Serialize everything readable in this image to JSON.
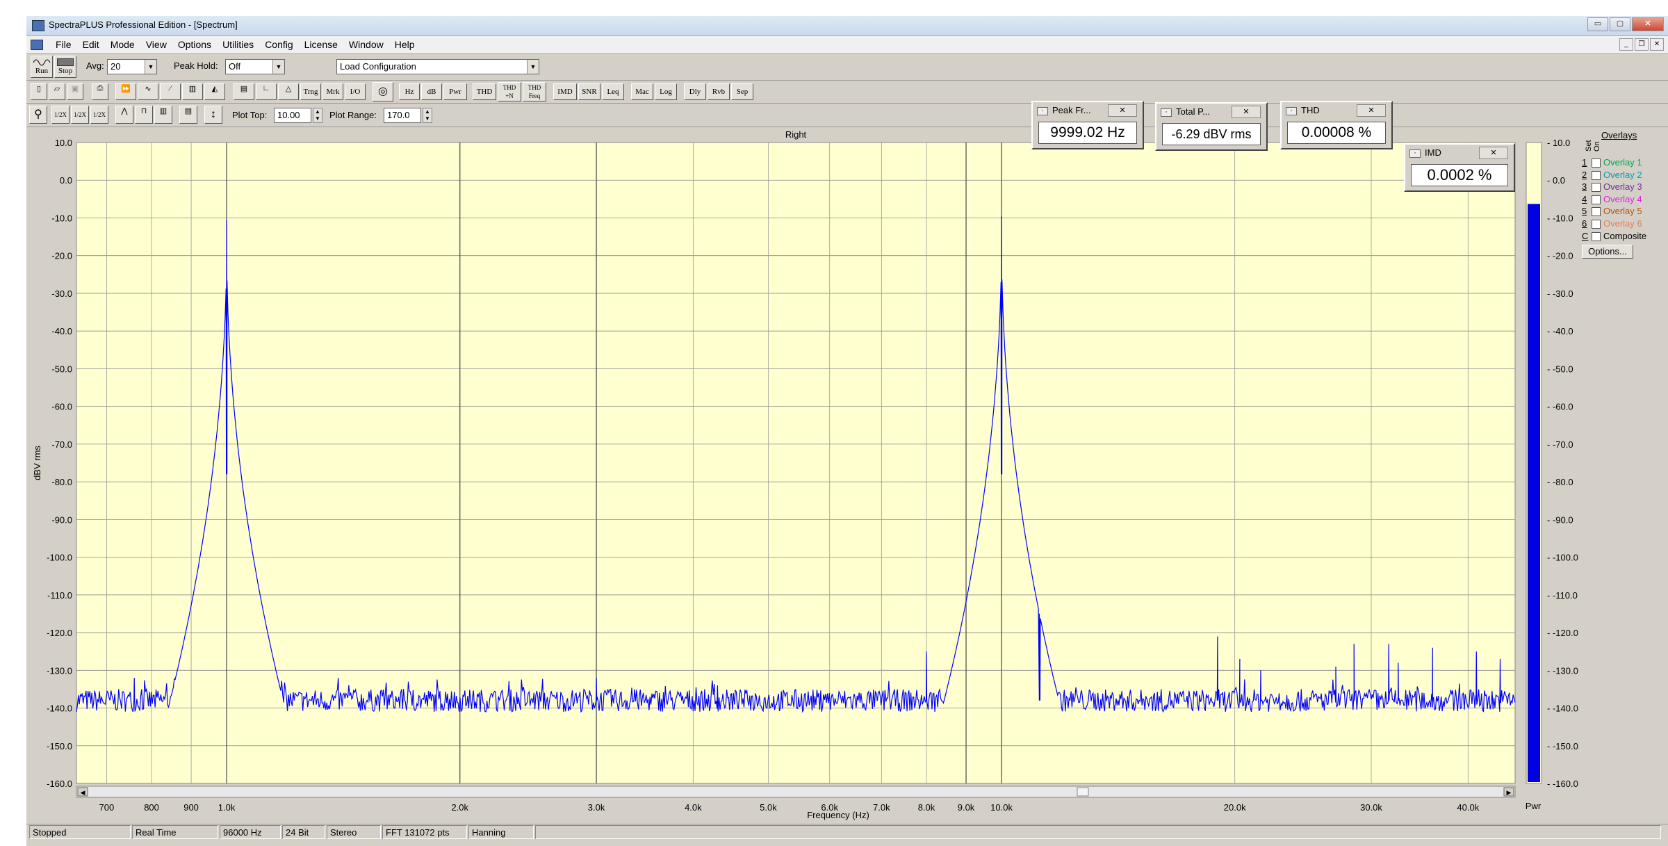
{
  "window": {
    "title": "SpectraPLUS Professional Edition - [Spectrum]",
    "controls": [
      "▭",
      "▢",
      "✕"
    ]
  },
  "menu": [
    "File",
    "Edit",
    "Mode",
    "View",
    "Options",
    "Utilities",
    "Config",
    "License",
    "Window",
    "Help"
  ],
  "toolbar1": {
    "run": "Run",
    "stop": "Stop",
    "avg_label": "Avg:",
    "avg_value": "20",
    "peak_label": "Peak Hold:",
    "peak_value": "Off",
    "config_value": "Load Configuration"
  },
  "toolbar2": {
    "buttons": [
      "Trng",
      "Mrk",
      "I/O",
      "Hz",
      "dB",
      "Pwr",
      "THD",
      "THD +N",
      "THD Freq",
      "IMD",
      "SNR",
      "Leq",
      "Mac",
      "Log",
      "Dly",
      "Rvb",
      "Sep"
    ]
  },
  "toolbar3": {
    "zoom_buttons": [
      "1/2X",
      "1/2X",
      "1/2X"
    ],
    "plot_top_label": "Plot Top:",
    "plot_top_value": "10.00",
    "plot_range_label": "Plot Range:",
    "plot_range_value": "170.0"
  },
  "meters": {
    "peak": {
      "title": "Peak Fr...",
      "value": "9999.02 Hz"
    },
    "total": {
      "title": "Total P...",
      "value": "-6.29 dBV rms"
    },
    "thd": {
      "title": "THD",
      "value": "0.00008 %"
    },
    "imd": {
      "title": "IMD",
      "value": "0.0002 %"
    }
  },
  "overlays": {
    "header": "Overlays",
    "set_label": "Set",
    "on_label": "On",
    "items": [
      {
        "num": "1",
        "label": "Overlay 1",
        "color": "#00a651"
      },
      {
        "num": "2",
        "label": "Overlay 2",
        "color": "#00a0b0"
      },
      {
        "num": "3",
        "label": "Overlay 3",
        "color": "#7030a0"
      },
      {
        "num": "4",
        "label": "Overlay 4",
        "color": "#e020e0"
      },
      {
        "num": "5",
        "label": "Overlay 5",
        "color": "#c05000"
      },
      {
        "num": "6",
        "label": "Overlay 6",
        "color": "#e08060"
      },
      {
        "num": "C",
        "label": "Composite",
        "color": "#000000"
      }
    ],
    "options": "Options..."
  },
  "chart_data": {
    "type": "line",
    "title": "Right",
    "xlabel": "Frequency (Hz)",
    "ylabel": "dBV rms",
    "x_scale": "log",
    "xlim": [
      640,
      46000
    ],
    "ylim": [
      -160,
      10
    ],
    "x_ticks": [
      700,
      800,
      900,
      1000,
      2000,
      3000,
      4000,
      5000,
      6000,
      7000,
      8000,
      9000,
      10000,
      20000,
      30000,
      40000
    ],
    "x_tick_labels": [
      "700",
      "800",
      "900",
      "1.0k",
      "2.0k",
      "3.0k",
      "4.0k",
      "5.0k",
      "6.0k",
      "7.0k",
      "8.0k",
      "9.0k",
      "10.0k",
      "20.0k",
      "30.0k",
      "40.0k"
    ],
    "y_ticks": [
      10,
      0,
      -10,
      -20,
      -30,
      -40,
      -50,
      -60,
      -70,
      -80,
      -90,
      -100,
      -110,
      -120,
      -130,
      -140,
      -150,
      -160
    ],
    "y_tick_labels": [
      "10.0",
      "0.0",
      "-10.0",
      "-20.0",
      "-30.0",
      "-40.0",
      "-50.0",
      "-60.0",
      "-70.0",
      "-80.0",
      "-90.0",
      "-100.0",
      "-110.0",
      "-120.0",
      "-130.0",
      "-140.0",
      "-150.0",
      "-160.0"
    ],
    "noise_floor": -138,
    "peaks": [
      {
        "x": 1000,
        "y": -10.5
      },
      {
        "x": 10000,
        "y": -9.5
      }
    ],
    "spurs": [
      {
        "x": 760,
        "y": -132
      },
      {
        "x": 3000,
        "y": -132
      },
      {
        "x": 4300,
        "y": -134
      },
      {
        "x": 8000,
        "y": -125
      },
      {
        "x": 11200,
        "y": -126
      },
      {
        "x": 19000,
        "y": -121
      },
      {
        "x": 20300,
        "y": -127
      },
      {
        "x": 21600,
        "y": -130
      },
      {
        "x": 27000,
        "y": -129
      },
      {
        "x": 28500,
        "y": -123
      },
      {
        "x": 31600,
        "y": -123
      },
      {
        "x": 32500,
        "y": -128
      },
      {
        "x": 36000,
        "y": -124
      },
      {
        "x": 41000,
        "y": -125
      },
      {
        "x": 44000,
        "y": -127
      }
    ],
    "series_color": "#0000ff",
    "plot_background": "#ffffd0",
    "level_meter": {
      "label": "Pwr",
      "value": -6.29
    }
  },
  "status": {
    "state": "Stopped",
    "mode": "Real Time",
    "rate": "96000 Hz",
    "bits": "24 Bit",
    "channels": "Stereo",
    "fft": "FFT 131072 pts",
    "window": "Hanning"
  }
}
